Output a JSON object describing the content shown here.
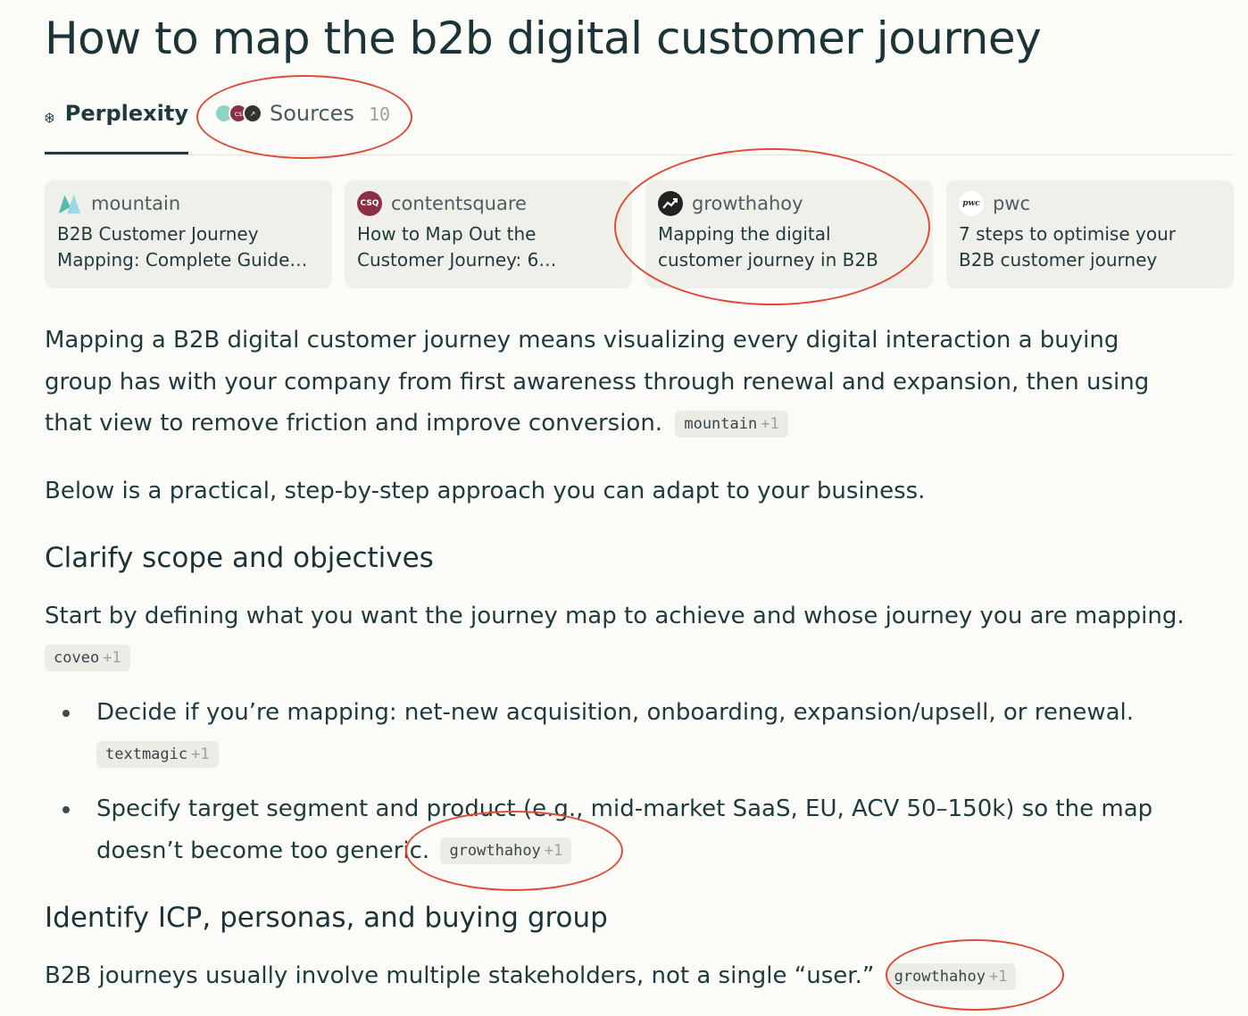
{
  "title": "How to map the b2b digital customer journey",
  "tabs": {
    "perplexity_label": "Perplexity",
    "sources_label": "Sources",
    "sources_count": "10"
  },
  "sources": [
    {
      "site": "mountain",
      "title_line1": "B2B Customer Journey",
      "title_line2": "Mapping: Complete Guide…",
      "icon_color": "#5ab8a8"
    },
    {
      "site": "contentsquare",
      "title_line1": "How to Map Out the",
      "title_line2": "Customer Journey: 6…",
      "icon_color": "#8c2f45",
      "icon_text": "CSQ"
    },
    {
      "site": "growthahoy",
      "title_line1": "Mapping the digital",
      "title_line2": "customer journey in B2B",
      "icon_color": "#222222"
    },
    {
      "site": "pwc",
      "title_line1": "7 steps to optimise your",
      "title_line2": "B2B customer journey",
      "icon_color": "#ffffff",
      "icon_text": "pwc"
    }
  ],
  "intro": {
    "line1": "Mapping a B2B digital customer journey means visualizing every digital interaction a buying",
    "line2": "group has with your company from first awareness through renewal and expansion, then using",
    "line3": "that view to remove friction and improve conversion.",
    "chip": "mountain",
    "chip_plus": "+1"
  },
  "below": "Below is a practical, step-by-step approach you can adapt to your business.",
  "section1": {
    "heading": "Clarify scope and objectives",
    "text": "Start by defining what you want the journey map to achieve and whose journey you are mapping.",
    "chip": "coveo",
    "chip_plus": "+1",
    "bullets": [
      {
        "line1": "Decide if you’re mapping: net-new acquisition, onboarding, expansion/upsell, or renewal.",
        "line2": "",
        "chip": "textmagic",
        "chip_plus": "+1"
      },
      {
        "line1": "Specify target segment and product (e.g., mid-market SaaS, EU, ACV 50–150k) so the map",
        "line2": "doesn’t become too generic.",
        "chip": "growthahoy",
        "chip_plus": "+1"
      }
    ]
  },
  "section2": {
    "heading": "Identify ICP, personas, and buying group",
    "text": "B2B journeys usually involve multiple stakeholders, not a single “user.”",
    "chip": "growthahoy",
    "chip_plus": "+1"
  },
  "colors": {
    "text": "#1f3a3d",
    "background": "#fbfbf8",
    "card": "#f0f0eb",
    "annotation": "#e04b38"
  }
}
